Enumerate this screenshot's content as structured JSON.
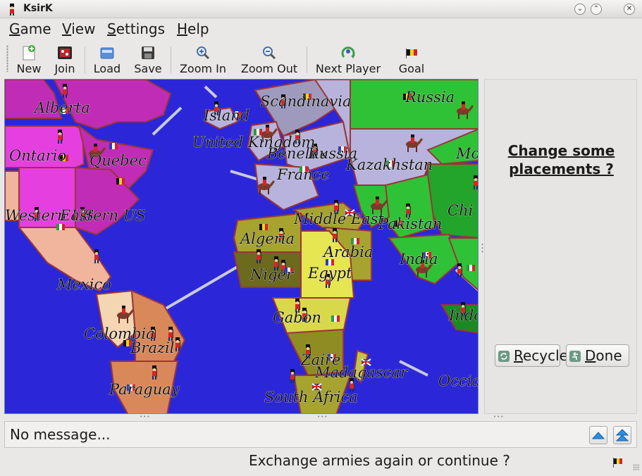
{
  "window": {
    "title": "KsirK"
  },
  "menu": [
    {
      "underline": "G",
      "rest": "ame"
    },
    {
      "underline": "V",
      "rest": "iew"
    },
    {
      "underline": "S",
      "rest": "ettings"
    },
    {
      "underline": "H",
      "rest": "elp"
    }
  ],
  "toolbar": {
    "new": "New",
    "join": "Join",
    "load": "Load",
    "save": "Save",
    "zoom_in": "Zoom In",
    "zoom_out": "Zoom Out",
    "next_player": "Next Player",
    "goal": "Goal"
  },
  "map": {
    "labels": {
      "alberta": "Alberta",
      "ontario": "Ontario",
      "quebec": "Quebec",
      "western_us": "Western US",
      "eastern_us": "Eastern US",
      "mexico": "Mexico",
      "colombia": "Colombia",
      "brazil": "Brazil",
      "paraguay": "Paraguay",
      "iceland": "Island",
      "scandinavia": "Scandinavia",
      "united_kingdom": "United Kingdom",
      "benelux": "Benelux",
      "russia_w": "Russia",
      "france": "France",
      "russia": "Russia",
      "kazakhstan": "Kazakhstan",
      "mongolia": "Mo",
      "china": "Chi",
      "pakistan": "Pakistan",
      "middle_east": "Middle East",
      "india": "India",
      "algeria": "Algeria",
      "niger": "Niger",
      "egypt": "Egypt",
      "arabia": "Arabia",
      "gabon": "Gabon",
      "zaire": "Zaire",
      "madagascar": "Madagascar",
      "south_africa": "South Africa",
      "indonesia": "Indo",
      "oceania": "Occia"
    }
  },
  "panel": {
    "title_line1": "Change some",
    "title_line2": "placements ?",
    "recycle_u": "R",
    "recycle_rest": "ecycle",
    "done_u": "D",
    "done_rest": "one"
  },
  "messages": {
    "text": "No message..."
  },
  "status": {
    "text": "Exchange armies again or continue ?"
  },
  "colors": {
    "ocean": "#2b27d9",
    "north_america_magenta": "#c02cb6",
    "north_america_pink": "#e53fe0",
    "europe_lilac": "#b7b3dc",
    "asia_green": "#2fc236",
    "africa_olive": "#a6a32f",
    "south_america_tan": "#d9885a",
    "frontier_red": "#9b3538"
  }
}
